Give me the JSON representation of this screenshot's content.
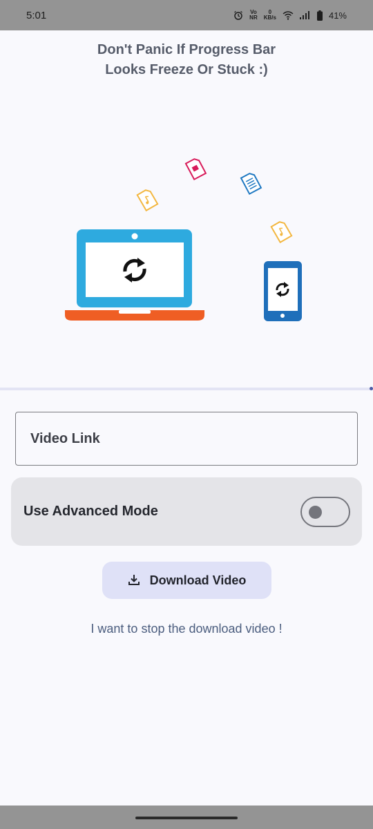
{
  "status_bar": {
    "time": "5:01",
    "network_top": "Vo",
    "network_bottom": "NR",
    "speed_value": "0",
    "speed_unit": "KB/s",
    "battery": "41%",
    "icons": [
      "alarm-icon",
      "volte-icon",
      "wifi-icon",
      "signal-icon",
      "battery-icon"
    ]
  },
  "header": {
    "message": "Don't Panic If Progress Bar\n Looks Freeze Or Stuck :)"
  },
  "progress": {
    "value": 0.0
  },
  "form": {
    "link_placeholder": "Video Link",
    "advanced_mode_label": "Use Advanced Mode",
    "advanced_mode_enabled": false
  },
  "actions": {
    "download_label": "Download Video",
    "stop_link": "I want to stop the download video !"
  },
  "colors": {
    "laptop_blue": "#2eaadf",
    "laptop_base": "#ef5e24",
    "phone_blue": "#1f6fba",
    "music_file": "#f3b740",
    "image_file": "#d81b5a",
    "doc_file": "#1e78c2",
    "accent": "#4f5ba6"
  }
}
